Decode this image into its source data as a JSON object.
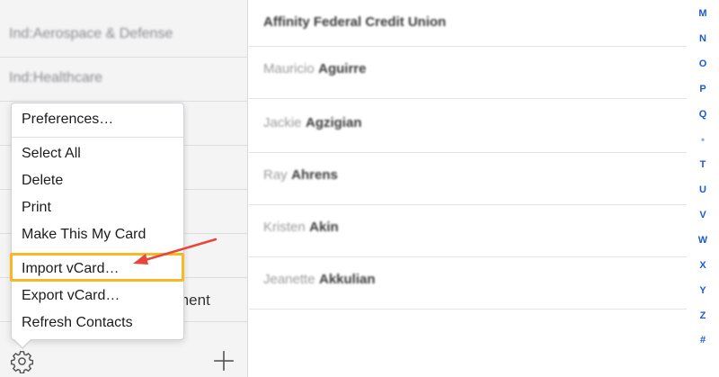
{
  "sidebar": {
    "groups": [
      {
        "label": "Ind:Aerospace & Defense"
      },
      {
        "label": "Ind:Healthcare"
      }
    ],
    "partial_label": "ment"
  },
  "menu": {
    "items": [
      {
        "label": "Preferences…"
      },
      {
        "label": "Select All"
      },
      {
        "label": "Delete"
      },
      {
        "label": "Print"
      },
      {
        "label": "Make This My Card"
      },
      {
        "label": "Import vCard…"
      },
      {
        "label": "Export vCard…"
      },
      {
        "label": "Refresh Contacts"
      }
    ]
  },
  "contacts": [
    {
      "first": "",
      "last": "",
      "company": "Affinity Federal Credit Union"
    },
    {
      "first": "Mauricio",
      "last": "Aguirre"
    },
    {
      "first": "Jackie",
      "last": "Agzigian"
    },
    {
      "first": "Ray",
      "last": "Ahrens"
    },
    {
      "first": "Kristen",
      "last": "Akin"
    },
    {
      "first": "Jeanette",
      "last": "Akkulian"
    }
  ],
  "index": [
    "M",
    "N",
    "O",
    "P",
    "Q",
    "•",
    "T",
    "U",
    "V",
    "W",
    "X",
    "Y",
    "Z",
    "#"
  ],
  "colors": {
    "highlight": "#f7b826",
    "arrow": "#e8453c",
    "index": "#1a5cd1"
  },
  "icons": {
    "settings": "gear-icon",
    "add": "plus-icon"
  }
}
